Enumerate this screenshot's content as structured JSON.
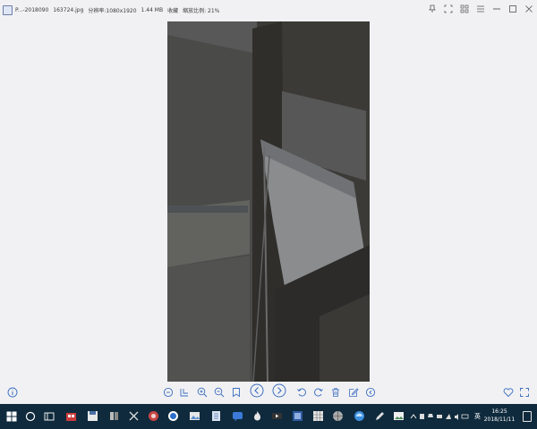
{
  "window": {
    "title_segments": [
      "P...-2018090",
      "163724.jpg",
      "分辨率:1080x1920",
      "1.44 MB",
      "收藏",
      "缩放比例: 21%"
    ]
  },
  "titlebar_tools": [
    "pin-icon",
    "fullscreen-icon",
    "grid-icon",
    "menu-icon",
    "minimize-icon",
    "maximize-icon",
    "close-icon"
  ],
  "viewer_toolbar": {
    "buttons": [
      {
        "name": "fit-window-button",
        "icon": "fit-icon"
      },
      {
        "name": "actual-size-button",
        "icon": "actual-size-icon"
      },
      {
        "name": "zoom-in-button",
        "icon": "zoom-in-icon"
      },
      {
        "name": "zoom-out-button",
        "icon": "zoom-out-icon"
      },
      {
        "name": "bookmark-button",
        "icon": "bookmark-icon"
      },
      {
        "name": "previous-button",
        "icon": "chevron-left-icon"
      },
      {
        "name": "next-button",
        "icon": "chevron-right-icon"
      },
      {
        "name": "rotate-left-button",
        "icon": "rotate-left-icon"
      },
      {
        "name": "rotate-right-button",
        "icon": "rotate-right-icon"
      },
      {
        "name": "delete-button",
        "icon": "trash-icon"
      },
      {
        "name": "edit-button",
        "icon": "edit-icon"
      },
      {
        "name": "more-button",
        "icon": "more-icon"
      }
    ],
    "left_info": "info-icon",
    "right_tools": [
      "favorite-icon",
      "expand-icon"
    ]
  },
  "taskbar": {
    "clock_time": "16:25",
    "clock_date": "2018/11/11",
    "ime_label": "英",
    "accent": "#0f2a3d"
  }
}
